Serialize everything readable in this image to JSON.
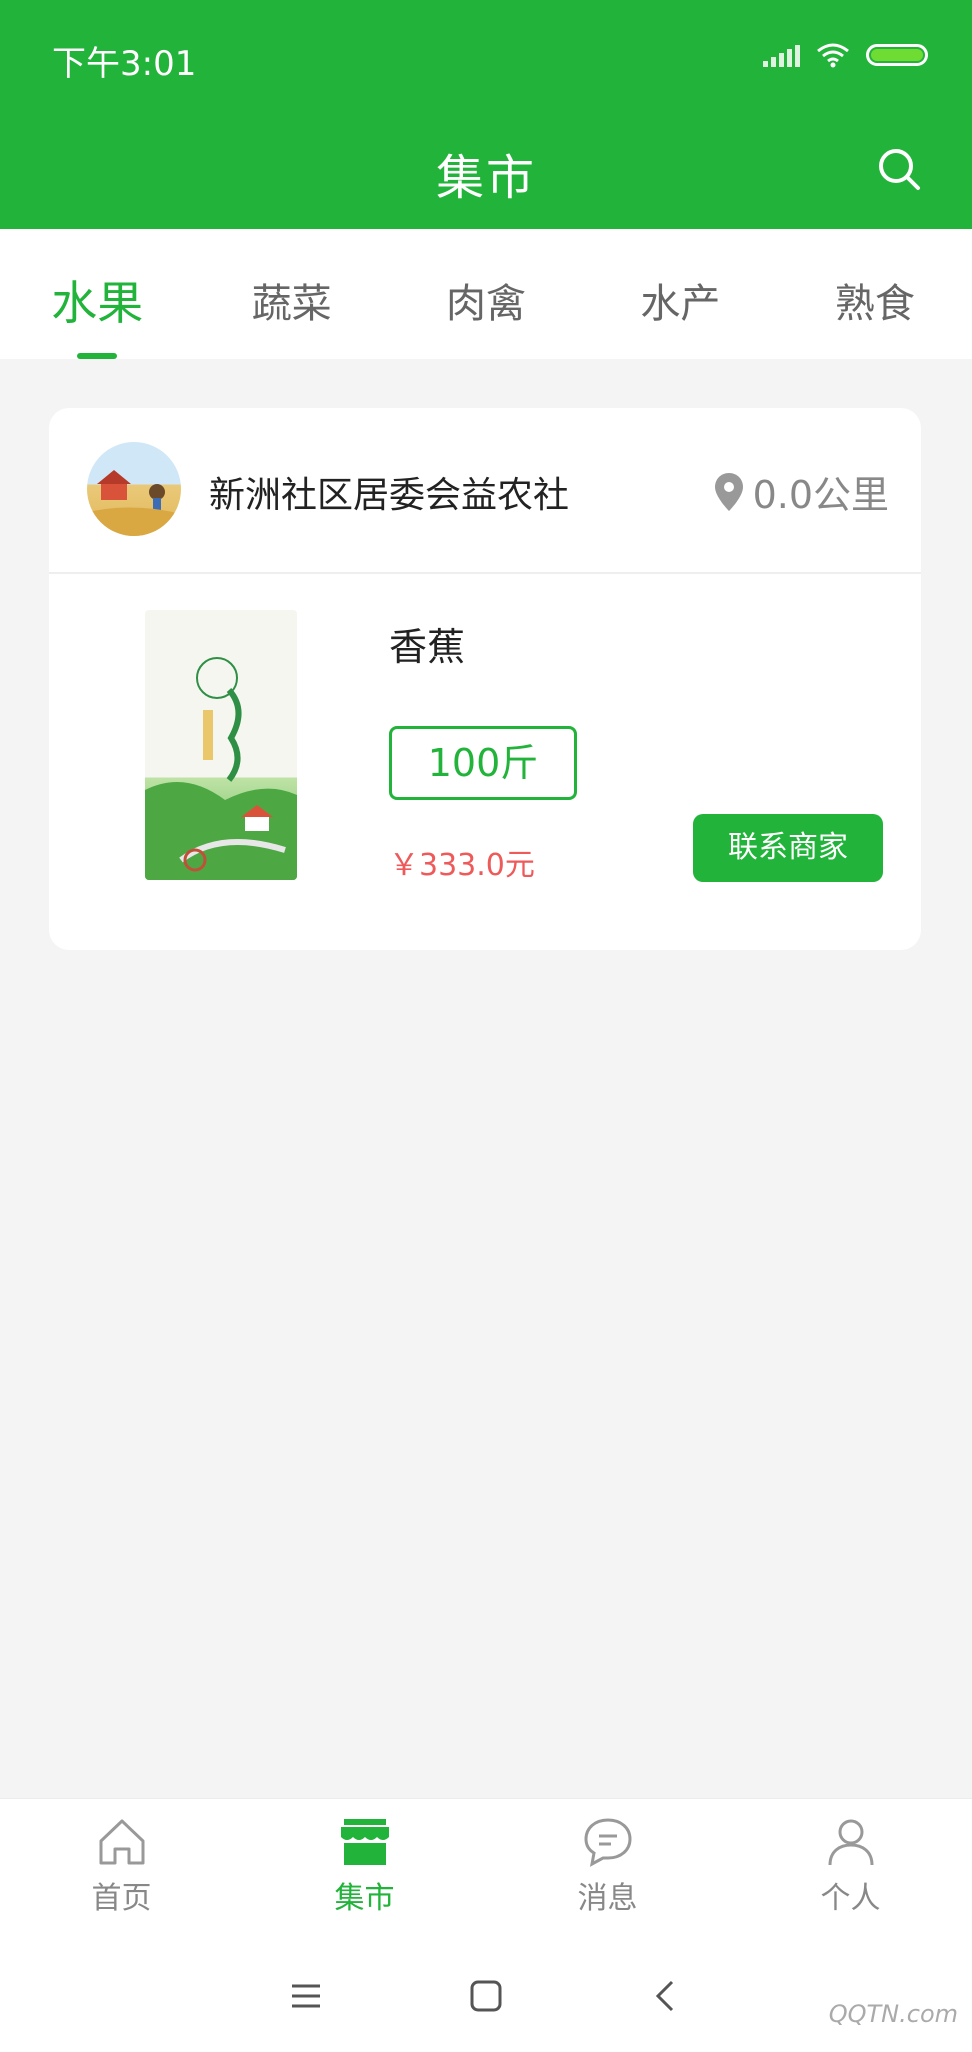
{
  "status_bar": {
    "time": "下午3:01"
  },
  "header": {
    "title": "集市",
    "search_icon": "search-icon"
  },
  "tabs": [
    {
      "label": "水果",
      "active": true
    },
    {
      "label": "蔬菜",
      "active": false
    },
    {
      "label": "肉禽",
      "active": false
    },
    {
      "label": "水产",
      "active": false
    },
    {
      "label": "熟食",
      "active": false
    }
  ],
  "shop": {
    "name": "新洲社区居委会益农社",
    "distance": "0.0公里"
  },
  "product": {
    "name": "香蕉",
    "quantity": "100斤",
    "price": "￥333.0元",
    "contact_label": "联系商家"
  },
  "bottom_nav": [
    {
      "label": "首页",
      "icon": "home-icon",
      "active": false
    },
    {
      "label": "集市",
      "icon": "market-icon",
      "active": true
    },
    {
      "label": "消息",
      "icon": "message-icon",
      "active": false
    },
    {
      "label": "个人",
      "icon": "person-icon",
      "active": false
    }
  ],
  "watermark": "QQTN.com",
  "colors": {
    "primary": "#22b33a",
    "price": "#ee5a5a",
    "background": "#f4f4f4"
  }
}
